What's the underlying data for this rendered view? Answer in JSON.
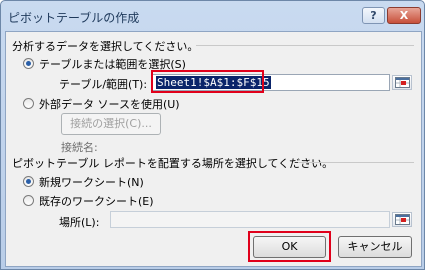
{
  "dialog": {
    "title": "ピボットテーブルの作成",
    "help_label": "?",
    "close_label": "X"
  },
  "section1": {
    "heading": "分析するデータを選択してください。",
    "option_table_label": "テーブルまたは範囲を選択(S)",
    "table_range_label": "テーブル/範囲(T):",
    "table_range_value": "Sheet1!$A$1:$F$15",
    "option_external_label": "外部データ ソースを使用(U)",
    "select_connection_label": "接続の選択(C)...",
    "connection_name_label": "接続名:"
  },
  "section2": {
    "heading": "ピボットテーブル レポートを配置する場所を選択してください。",
    "option_new_sheet_label": "新規ワークシート(N)",
    "option_existing_sheet_label": "既存のワークシート(E)",
    "location_label": "場所(L):",
    "location_value": ""
  },
  "buttons": {
    "ok_label": "OK",
    "cancel_label": "キャンセル"
  },
  "colors": {
    "highlight_box": "#e0001b",
    "selection_bg": "#0a246a"
  }
}
